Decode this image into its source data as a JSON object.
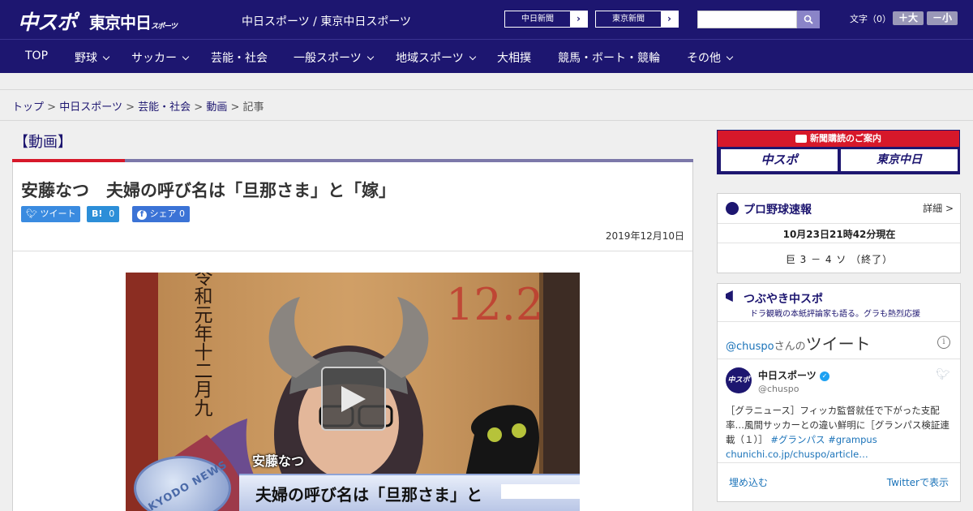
{
  "header": {
    "logo_main": "中スポ",
    "logo_tokyo": "東京中日",
    "logo_tokyo_sub": "スポーツ",
    "site_title": "中日スポーツ / 東京中日スポーツ",
    "ext_link_1": "中日新聞",
    "ext_link_2": "東京新聞",
    "search_placeholder": "",
    "font_size_label": "文字（0）",
    "font_plus": "＋大",
    "font_minus": "－小"
  },
  "nav": {
    "items": [
      "TOP",
      "野球",
      "サッカー",
      "芸能・社会",
      "一般スポーツ",
      "地域スポーツ",
      "大相撲",
      "競馬・ボート・競輪",
      "その他"
    ]
  },
  "breadcrumb": {
    "items": [
      "トップ",
      "中日スポーツ",
      "芸能・社会",
      "動画"
    ],
    "current": "記事",
    "separator": ">"
  },
  "article": {
    "section": "【動画】",
    "headline": "安藤なつ　夫婦の呼び名は「旦那さま」と「嫁」",
    "share": {
      "tweet": "ツイート",
      "hatena_icon": "B!",
      "hatena_count": "0",
      "facebook": "シェア",
      "facebook_count": "0"
    },
    "date": "2019年12月10日",
    "video": {
      "board_text": "令和元年十二月九",
      "board_number": "12.2",
      "caption_name": "安藤なつ",
      "caption_line": "夫婦の呼び名は「旦那さま」と",
      "news_badge": "KYODO NEWS"
    }
  },
  "sidebar": {
    "ad": {
      "title": "新聞購読のご案内",
      "logo_1": "中スポ",
      "logo_2": "東京中日"
    },
    "baseball": {
      "title": "プロ野球速報",
      "more": "詳細 >",
      "timestamp": "10月23日21時42分現在",
      "score": "巨 3 － 4 ソ （終了）"
    },
    "tweets": {
      "title": "つぶやき中スポ",
      "subtitle": "ドラ観戦の本紙評論家も語る。グラも熱烈応援",
      "handle_prefix": "@chuspo",
      "handle_mid": "さんの",
      "handle_big": "ツイート",
      "author": "中日スポーツ",
      "author_handle": "@chuspo",
      "tweet_text": "［グラニュース］フィッカ監督就任で下がった支配率…風間サッカーとの違い鮮明に［グランパス検証連載（１）］",
      "tags": "#グランパス #grampus",
      "link": "chunichi.co.jp/chuspo/article…",
      "embed": "埋め込む",
      "view_on_twitter": "Twitterで表示"
    }
  },
  "colors": {
    "brand_navy": "#1d1670",
    "accent_red": "#d7182a",
    "link_blue": "#1b73b9"
  }
}
